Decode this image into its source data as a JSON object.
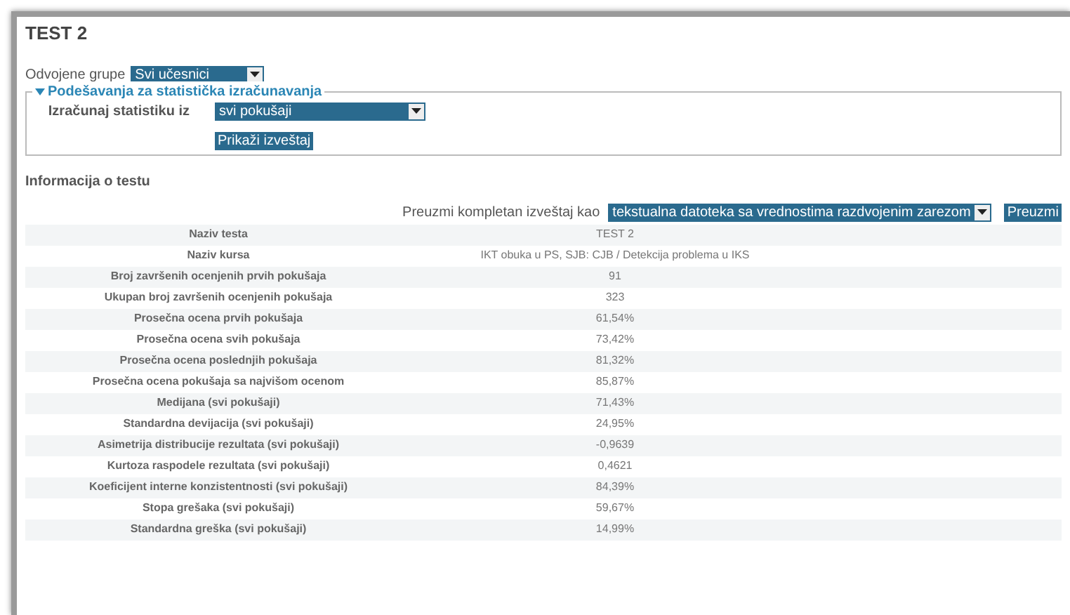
{
  "title": "TEST 2",
  "groups": {
    "label": "Odvojene grupe",
    "value": "Svi učesnici"
  },
  "settings": {
    "legend": "Podešavanja za statistička izračunavanja",
    "expanded": true,
    "label": "Izračunaj statistiku iz",
    "value": "svi pokušaji",
    "button": "Prikaži izveštaj"
  },
  "info": {
    "heading": "Informacija o testu",
    "download_label": "Preuzmi kompletan izveštaj kao",
    "download_format": "tekstualna datoteka sa vrednostima razdvojenim zarezom",
    "download_button": "Preuzmi",
    "rows": [
      {
        "label": "Naziv testa",
        "value": "TEST 2"
      },
      {
        "label": "Naziv kursa",
        "value": "IKT obuka u PS, SJB: CJB / Detekcija problema u IKS"
      },
      {
        "label": "Broj završenih ocenjenih prvih pokušaja",
        "value": "91"
      },
      {
        "label": "Ukupan broj završenih ocenjenih pokušaja",
        "value": "323"
      },
      {
        "label": "Prosečna ocena prvih pokušaja",
        "value": "61,54%"
      },
      {
        "label": "Prosečna ocena svih pokušaja",
        "value": "73,42%"
      },
      {
        "label": "Prosečna ocena poslednjih pokušaja",
        "value": "81,32%"
      },
      {
        "label": "Prosečna ocena pokušaja sa najvišom ocenom",
        "value": "85,87%"
      },
      {
        "label": "Medijana (svi pokušaji)",
        "value": "71,43%"
      },
      {
        "label": "Standardna devijacija (svi pokušaji)",
        "value": "24,95%"
      },
      {
        "label": "Asimetrija distribucije rezultata (svi pokušaji)",
        "value": "-0,9639"
      },
      {
        "label": "Kurtoza raspodele rezultata (svi pokušaji)",
        "value": "0,4621"
      },
      {
        "label": "Koeficijent interne konzistentnosti (svi pokušaji)",
        "value": "84,39%"
      },
      {
        "label": "Stopa grešaka (svi pokušaji)",
        "value": "59,67%"
      },
      {
        "label": "Standardna greška (svi pokušaji)",
        "value": "14,99%"
      }
    ]
  }
}
